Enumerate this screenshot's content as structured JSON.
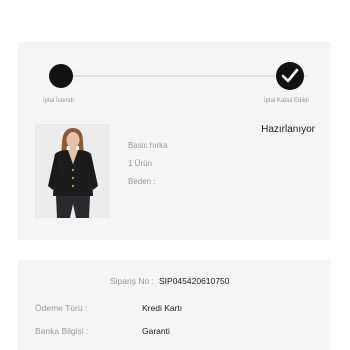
{
  "steps": {
    "first_label": "İptal İstendi",
    "second_label": "İptal Kabul Edildi"
  },
  "order": {
    "status": "Hazırlanıyor",
    "product_name": "Basic hırka",
    "quantity": "1 Ürün",
    "size_label": "Beden :"
  },
  "info": {
    "order_no_label": "Sipariş No :",
    "order_no_value": "SIP045420610750",
    "payment_label": "Ödeme Türü :",
    "payment_value": "Kredi Kartı",
    "bank_label": "Banka Bilgisi :",
    "bank_value": "Garanti"
  },
  "colors": {
    "card_bg": "#f5f5f5",
    "step_active": "#111111",
    "muted_text": "#999999"
  },
  "icons": {
    "step_complete": "checkmark-icon"
  }
}
